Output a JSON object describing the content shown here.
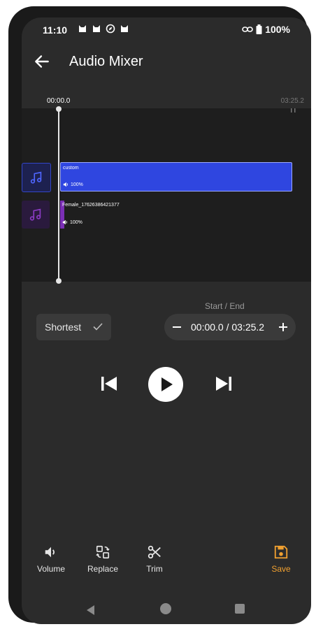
{
  "status_bar": {
    "time": "11:10",
    "battery": "100%"
  },
  "app_bar": {
    "title": "Audio Mixer"
  },
  "timeline": {
    "start_time": "00:00.0",
    "end_time": "03:25.2",
    "tracks": [
      {
        "name": "custom",
        "volume": "100%",
        "color": "#2f46e0"
      },
      {
        "name": "Female_17626386421377",
        "volume": "100%",
        "color": "#7b2fb5"
      }
    ]
  },
  "controls": {
    "mode_label": "Shortest",
    "start_end_label": "Start / End",
    "range_value": "00:00.0 / 03:25.2"
  },
  "toolbar": {
    "volume_label": "Volume",
    "replace_label": "Replace",
    "trim_label": "Trim",
    "save_label": "Save",
    "save_color": "#f0a030"
  }
}
